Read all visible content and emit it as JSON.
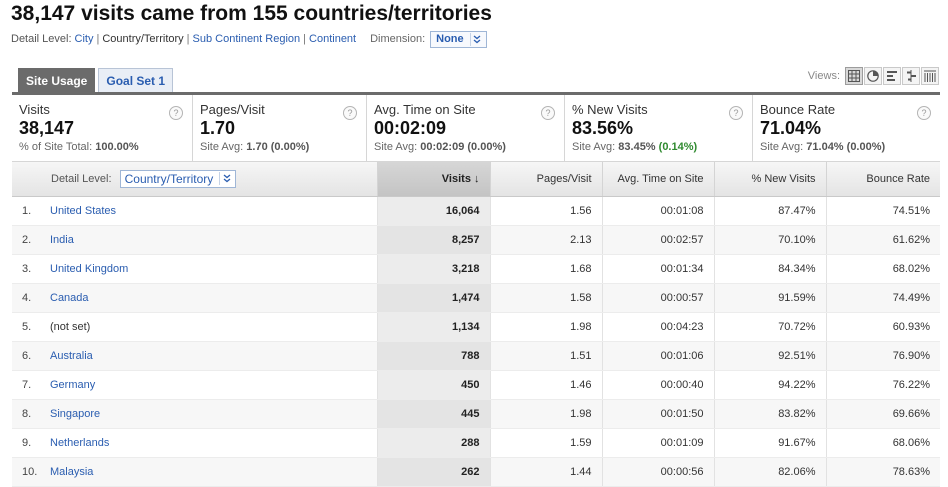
{
  "title": "38,147 visits came from 155 countries/territories",
  "detail_level": {
    "label": "Detail Level:",
    "options": [
      {
        "label": "City",
        "current": false
      },
      {
        "label": "Country/Territory",
        "current": true
      },
      {
        "label": "Sub Continent Region",
        "current": false
      },
      {
        "label": "Continent",
        "current": false
      }
    ],
    "separator": "|"
  },
  "dimension": {
    "label": "Dimension:",
    "value": "None"
  },
  "tabs": [
    {
      "label": "Site Usage",
      "active": true
    },
    {
      "label": "Goal Set 1",
      "active": false
    }
  ],
  "views": {
    "label": "Views:",
    "buttons": [
      "table-view-icon",
      "pie-chart-icon",
      "performance-view-icon",
      "comparison-view-icon",
      "pivot-view-icon"
    ]
  },
  "scorecard": [
    {
      "name": "Visits",
      "value": "38,147",
      "sub_label": "% of Site Total:",
      "sub_value": "100.00%",
      "delta": ""
    },
    {
      "name": "Pages/Visit",
      "value": "1.70",
      "sub_label": "Site Avg:",
      "sub_value": "1.70",
      "delta": "(0.00%)"
    },
    {
      "name": "Avg. Time on Site",
      "value": "00:02:09",
      "sub_label": "Site Avg:",
      "sub_value": "00:02:09",
      "delta": "(0.00%)"
    },
    {
      "name": "% New Visits",
      "value": "83.56%",
      "sub_label": "Site Avg:",
      "sub_value": "83.45%",
      "delta": "(0.14%)"
    },
    {
      "name": "Bounce Rate",
      "value": "71.04%",
      "sub_label": "Site Avg:",
      "sub_value": "71.04%",
      "delta": "(0.00%)"
    }
  ],
  "help_glyph": "?",
  "table": {
    "detail_label": "Detail Level:",
    "detail_value": "Country/Territory",
    "columns": [
      "Visits",
      "Pages/Visit",
      "Avg. Time on Site",
      "% New Visits",
      "Bounce Rate"
    ],
    "sort_arrow": "↓",
    "rows": [
      {
        "rank": "1.",
        "name": "United States",
        "visits": "16,064",
        "ppv": "1.56",
        "time": "00:01:08",
        "new": "87.47%",
        "bounce": "74.51%"
      },
      {
        "rank": "2.",
        "name": "India",
        "visits": "8,257",
        "ppv": "2.13",
        "time": "00:02:57",
        "new": "70.10%",
        "bounce": "61.62%"
      },
      {
        "rank": "3.",
        "name": "United Kingdom",
        "visits": "3,218",
        "ppv": "1.68",
        "time": "00:01:34",
        "new": "84.34%",
        "bounce": "68.02%"
      },
      {
        "rank": "4.",
        "name": "Canada",
        "visits": "1,474",
        "ppv": "1.58",
        "time": "00:00:57",
        "new": "91.59%",
        "bounce": "74.49%"
      },
      {
        "rank": "5.",
        "name": "(not set)",
        "visits": "1,134",
        "ppv": "1.98",
        "time": "00:04:23",
        "new": "70.72%",
        "bounce": "60.93%"
      },
      {
        "rank": "6.",
        "name": "Australia",
        "visits": "788",
        "ppv": "1.51",
        "time": "00:01:06",
        "new": "92.51%",
        "bounce": "76.90%"
      },
      {
        "rank": "7.",
        "name": "Germany",
        "visits": "450",
        "ppv": "1.46",
        "time": "00:00:40",
        "new": "94.22%",
        "bounce": "76.22%"
      },
      {
        "rank": "8.",
        "name": "Singapore",
        "visits": "445",
        "ppv": "1.98",
        "time": "00:01:50",
        "new": "83.82%",
        "bounce": "69.66%"
      },
      {
        "rank": "9.",
        "name": "Netherlands",
        "visits": "288",
        "ppv": "1.59",
        "time": "00:01:09",
        "new": "91.67%",
        "bounce": "68.06%"
      },
      {
        "rank": "10.",
        "name": "Malaysia",
        "visits": "262",
        "ppv": "1.44",
        "time": "00:00:56",
        "new": "82.06%",
        "bounce": "78.63%"
      }
    ]
  }
}
